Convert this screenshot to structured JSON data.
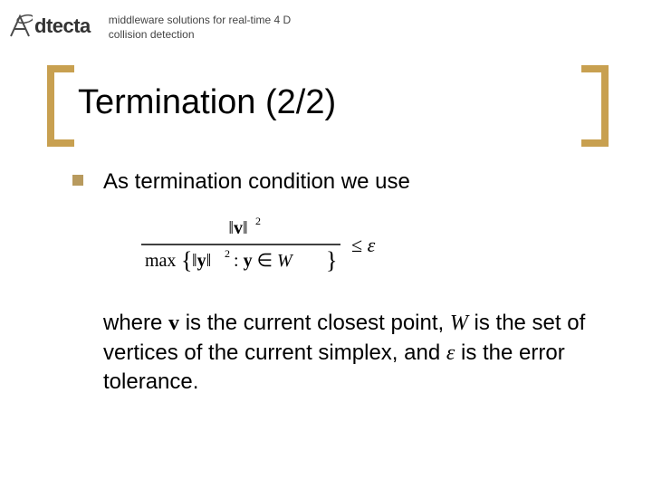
{
  "header": {
    "logo_text": "dtecta",
    "subtitle": "middleware solutions for real-time 4 D collision detection"
  },
  "slide": {
    "title": "Termination (2/2)",
    "bullet1": "As termination condition we use",
    "body_pre": "where ",
    "var_v": "v",
    "body_mid1": " is the current closest point, ",
    "var_W": "W",
    "body_mid2": " is the set of vertices of the current simplex, and ",
    "var_eps": "ε",
    "body_end": " is the error tolerance."
  },
  "formula": {
    "numerator_left": "‖",
    "numerator_v": "v",
    "numerator_right": "‖",
    "exp": "2",
    "denom_max": "max",
    "denom_lbrace": "{",
    "denom_y": "y",
    "denom_colon": " : ",
    "denom_in": " ∈ ",
    "denom_W": "W",
    "denom_rbrace": "}",
    "leq": " ≤ ",
    "eps": "ε"
  }
}
